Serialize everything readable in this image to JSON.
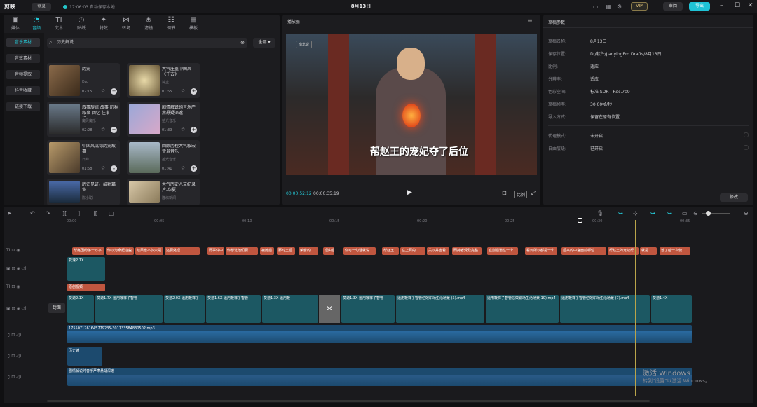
{
  "app": {
    "logo": "剪映",
    "user": "登录",
    "autosave": "17:06:03 自动保存本地",
    "title": "8月13日",
    "vip": "VIP",
    "review": "审阅",
    "export": "导出"
  },
  "tabs": [
    "媒体",
    "音频",
    "文本",
    "贴纸",
    "特效",
    "转场",
    "滤镜",
    "调节",
    "模板"
  ],
  "categories": [
    "音乐素材",
    "音效素材",
    "音频提取",
    "抖音收藏",
    "链接下载"
  ],
  "search": {
    "value": "历史解说",
    "filter": "全部"
  },
  "cards": [
    {
      "title": "历史",
      "author": "Kyo",
      "duration": "02:15"
    },
    {
      "title": "大气庄重中国风-《千古》",
      "author": "钟止",
      "duration": "01:55"
    },
    {
      "title": "叙事旋律 故事 历程 叙事 回忆 往事 纪...",
      "author": "魔贝魔乐",
      "duration": "02:28"
    },
    {
      "title": "剧情解说纯音乐严肃悬疑深邃",
      "author": "拾光音乐",
      "duration": "01:39"
    },
    {
      "title": "中国风沉稳历史故事",
      "author": "日峰",
      "duration": "01:58"
    },
    {
      "title": "回顾历程大气叙宏背景音乐",
      "author": "拾光音乐",
      "duration": "01:41"
    },
    {
      "title": "历史见证、破壮篇业",
      "author": "陈小聪",
      "duration": ""
    },
    {
      "title": "大气历史人文纪录片-华夏",
      "author": "隆坊新闻",
      "duration": ""
    }
  ],
  "player": {
    "title": "播放器",
    "subtitle": "帮赵王的宠妃夺了后位",
    "watermark": "南北说",
    "current": "00:00:52:12",
    "total": "00:00:35:19",
    "ratio": "比例"
  },
  "draft": {
    "title": "草稿参数",
    "rows": [
      {
        "label": "草稿名称:",
        "value": "8月13日"
      },
      {
        "label": "保存位置:",
        "value": "D:/软件/JianyingPro Drafts/8月13日"
      },
      {
        "label": "比例:",
        "value": "适应"
      },
      {
        "label": "分辨率:",
        "value": "适应"
      },
      {
        "label": "色彩空间:",
        "value": "标准 SDR - Rec.709"
      },
      {
        "label": "草稿帧率:",
        "value": "30.00帧/秒"
      },
      {
        "label": "导入方式:",
        "value": "保留在原有位置"
      },
      {
        "label": "代理模式:",
        "value": "未开启"
      },
      {
        "label": "自由层级:",
        "value": "已开启"
      }
    ],
    "modify": "修改"
  },
  "ruler": [
    "00:00",
    "00:05",
    "00:10",
    "00:15",
    "00:20",
    "00:25",
    "00:30",
    "00:35"
  ],
  "timeline": {
    "text_clips": [
      "帮赵国纷争十万字",
      "你以为拿起这些",
      "结果也不仅只是",
      "还要处理",
      "荣誉的",
      "而事件中",
      "你想让他们要",
      "被她后",
      "那时王后",
      "理由后",
      "没想",
      "你可一句话就说",
      "帮赵王",
      "在上百的",
      "关以并当着",
      "而持者受取完整",
      "直刮后道性一个",
      "看到所以都是一个",
      "后来的中宫面前哪位",
      "帮赵王的宠妃帮",
      "就是",
      "遮了给一次使"
    ],
    "speed_clip": "变速2.1X",
    "title_clip": "原创视频",
    "main_clips": [
      "变速2.1X",
      "变速1.7X 运用鞭样子智管",
      "变速2.0X 运用鞭样子",
      "变速1.6X 运用鞭样子智管",
      "变速1.3X 运用鞭",
      "变速1.3X 运用鞭样子智管",
      "运用鞭样子智管信效职场生活场景 (5).mp4",
      "运用鞭样子智管信效职场生活场景 10).mp4",
      "运用鞭样子智管信效职场生活场景 (7).mp4",
      "变速1.4X"
    ],
    "cover": "封面",
    "audio1": "1755071761645779235-301133584830502.mp3",
    "audio2": "历史镜",
    "audio3": "剧情解说纯音乐严肃悬疑深邃"
  },
  "windows": {
    "line1": "激活 Windows",
    "line2": "转到\"设置\"以激活 Windows。"
  }
}
